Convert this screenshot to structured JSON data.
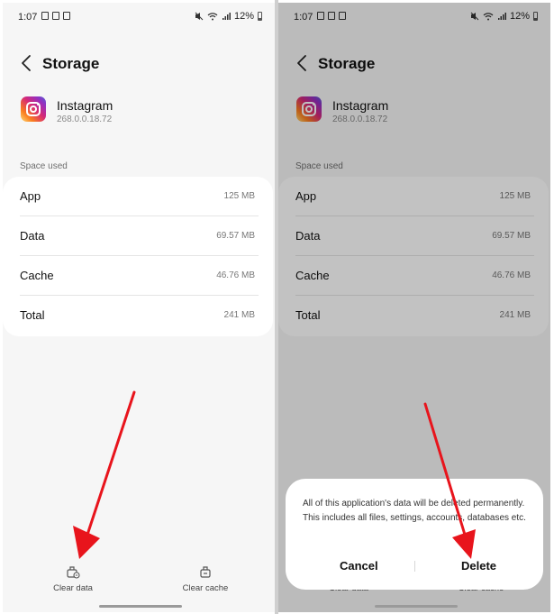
{
  "status": {
    "time": "1:07",
    "battery": "12%"
  },
  "header": {
    "title": "Storage"
  },
  "app": {
    "name": "Instagram",
    "version": "268.0.0.18.72"
  },
  "storage": {
    "section_label": "Space used",
    "rows": [
      {
        "label": "App",
        "value": "125 MB"
      },
      {
        "label": "Data",
        "value": "69.57 MB"
      },
      {
        "label": "Cache",
        "value": "46.76 MB"
      },
      {
        "label": "Total",
        "value": "241 MB"
      }
    ]
  },
  "actions": {
    "clear_data": "Clear data",
    "clear_cache": "Clear cache"
  },
  "dialog": {
    "message": "All of this application's data will be deleted permanently. This includes all files, settings, accounts, databases etc.",
    "cancel": "Cancel",
    "delete": "Delete"
  },
  "colors": {
    "annotation_arrow": "#e8141c",
    "app_icon_gradient": [
      "#feda75",
      "#fa7e1e",
      "#d62976",
      "#962fbf",
      "#4f5bd5"
    ]
  }
}
